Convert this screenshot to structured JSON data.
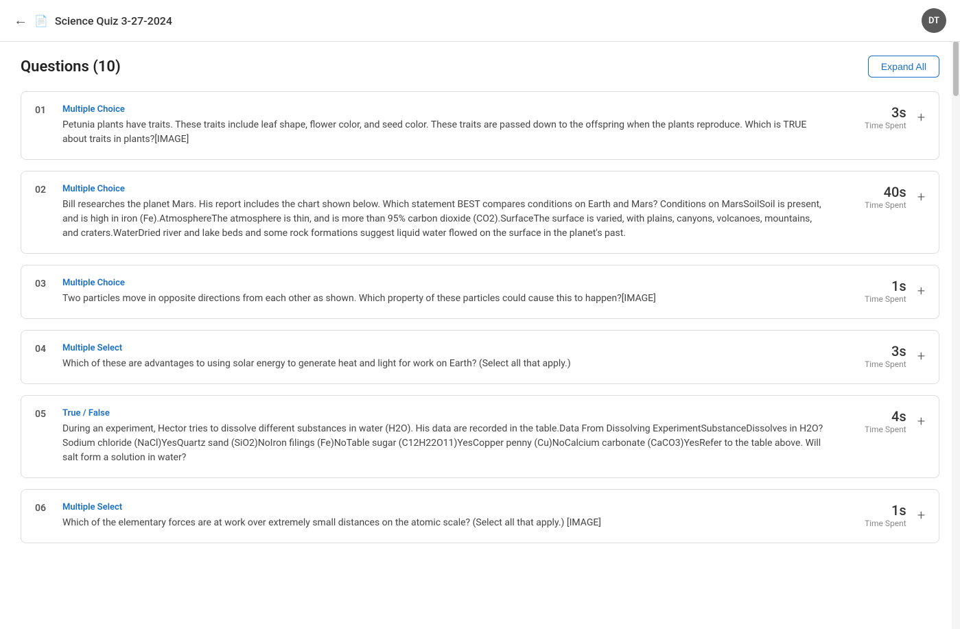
{
  "header": {
    "back_label": "←",
    "doc_icon": "📄",
    "quiz_title": "Science Quiz 3-27-2024",
    "avatar_initials": "DT"
  },
  "questions_section": {
    "title": "Questions (10)",
    "expand_all_label": "Expand All"
  },
  "questions": [
    {
      "number": "01",
      "type": "Multiple Choice",
      "text": "Petunia plants have traits. These traits include leaf shape, flower color, and seed color. These traits are passed down to the offspring when the plants reproduce. Which is TRUE about traits in plants?[IMAGE]",
      "time_value": "3s",
      "time_label": "Time Spent"
    },
    {
      "number": "02",
      "type": "Multiple Choice",
      "text": "Bill researches the planet Mars. His report includes the chart shown below. Which statement BEST compares conditions on Earth and Mars? Conditions on MarsSoilSoil is present, and is high in iron (Fe).AtmosphereThe atmosphere is thin, and is more than 95% carbon dioxide (CO2).SurfaceThe surface is varied, with plains, canyons, volcanoes, mountains, and craters.WaterDried river and lake beds and some rock formations suggest liquid water flowed on the surface in the planet's past.",
      "time_value": "40s",
      "time_label": "Time Spent"
    },
    {
      "number": "03",
      "type": "Multiple Choice",
      "text": "Two particles move in opposite directions from each other as shown. Which property of these particles could cause this to happen?[IMAGE]",
      "time_value": "1s",
      "time_label": "Time Spent"
    },
    {
      "number": "04",
      "type": "Multiple Select",
      "text": "Which of these are advantages to using solar energy to generate heat and light for work on Earth? (Select all that apply.)",
      "time_value": "3s",
      "time_label": "Time Spent"
    },
    {
      "number": "05",
      "type": "True / False",
      "text": "During an experiment, Hector tries to dissolve different substances in water (H2O). His data are recorded in the table.Data From Dissolving ExperimentSubstanceDissolves in H2O?Sodium chloride (NaCl)YesQuartz sand (SiO2)NoIron filings (Fe)NoTable sugar (C12H22O11)YesCopper penny (Cu)NoCalcium carbonate (CaCO3)YesRefer to the table above. Will salt form a solution in water?",
      "time_value": "4s",
      "time_label": "Time Spent"
    },
    {
      "number": "06",
      "type": "Multiple Select",
      "text": "Which of the elementary forces are at work over extremely small distances on the atomic scale? (Select all that apply.) [IMAGE]",
      "time_value": "1s",
      "time_label": "Time Spent"
    }
  ],
  "colors": {
    "question_type": "#1a6fc4",
    "expand_btn_border": "#1a6fc4",
    "avatar_bg": "#5a5a5a"
  }
}
